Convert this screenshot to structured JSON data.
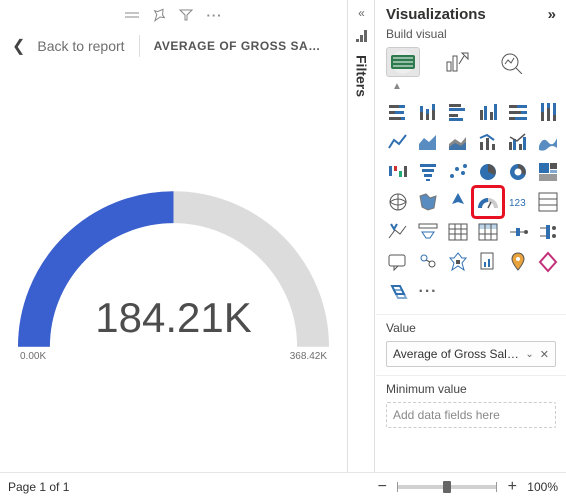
{
  "header": {
    "back_label": "Back to report",
    "title": "AVERAGE OF GROSS SAL…"
  },
  "filters": {
    "label": "Filters"
  },
  "gauge": {
    "value_label": "184.21K",
    "min_label": "0.00K",
    "max_label": "368.42K"
  },
  "visualizations": {
    "title": "Visualizations",
    "build_label": "Build visual",
    "icons": [
      {
        "name": "stacked-bar-chart",
        "selected": false
      },
      {
        "name": "stacked-column-chart"
      },
      {
        "name": "clustered-bar-chart"
      },
      {
        "name": "clustered-column-chart"
      },
      {
        "name": "100pct-stacked-bar-chart"
      },
      {
        "name": "100pct-stacked-column-chart"
      },
      {
        "name": "line-chart"
      },
      {
        "name": "area-chart"
      },
      {
        "name": "stacked-area-chart"
      },
      {
        "name": "line-and-stacked-column-chart"
      },
      {
        "name": "line-and-clustered-column-chart"
      },
      {
        "name": "ribbon-chart"
      },
      {
        "name": "waterfall-chart"
      },
      {
        "name": "funnel-chart"
      },
      {
        "name": "scatter-chart"
      },
      {
        "name": "pie-chart"
      },
      {
        "name": "donut-chart"
      },
      {
        "name": "treemap"
      },
      {
        "name": "map"
      },
      {
        "name": "filled-map"
      },
      {
        "name": "azure-map"
      },
      {
        "name": "gauge",
        "selected": true
      },
      {
        "name": "card"
      },
      {
        "name": "multi-row-card"
      },
      {
        "name": "kpi"
      },
      {
        "name": "slicer"
      },
      {
        "name": "table"
      },
      {
        "name": "matrix"
      },
      {
        "name": "r-script-visual"
      },
      {
        "name": "python-visual"
      },
      {
        "name": "q-and-a"
      },
      {
        "name": "key-influencers"
      },
      {
        "name": "decomposition-tree"
      },
      {
        "name": "paginated-report"
      },
      {
        "name": "arcgis-map"
      },
      {
        "name": "power-apps"
      },
      {
        "name": "narrative"
      },
      {
        "name": "more-visuals"
      }
    ],
    "value_section": "Value",
    "value_field": "Average of Gross Sales",
    "minvalue_section": "Minimum value",
    "minvalue_placeholder": "Add data fields here"
  },
  "footer": {
    "page_label": "Page 1 of 1",
    "zoom_label": "100%",
    "zoom_percent": 100
  },
  "chart_data": {
    "type": "gauge",
    "title": "Average of Gross Sales",
    "value": 184.21,
    "min": 0.0,
    "max": 368.42,
    "unit": "K",
    "fill_fraction": 0.5,
    "colors": {
      "fill": "#3a5fcf",
      "track": "#dcdcdc",
      "text": "#4d4d4d"
    }
  }
}
